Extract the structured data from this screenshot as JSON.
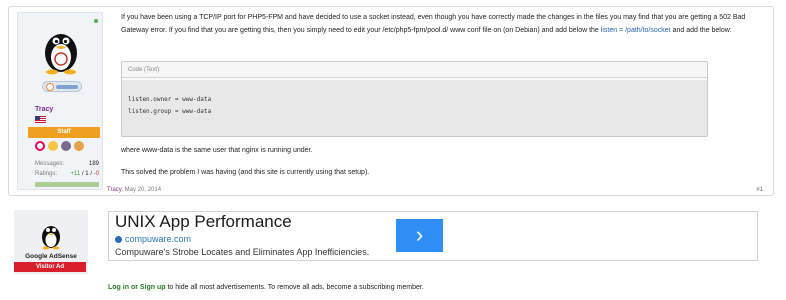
{
  "post": {
    "user": {
      "name": "Tracy",
      "role_banner": "Staff",
      "stats": [
        {
          "label": "Messages:",
          "value": "189"
        }
      ],
      "ratings": {
        "label": "Ratings:",
        "plus": "+11",
        "neutral": "1",
        "minus": "-0"
      }
    },
    "body": {
      "para1_a": "If you have been using a TCP/IP port for PHP5-FPM and have decided to use a socket instead, even though you have correctly made the changes in the files you may find that you are getting a 502 Bad Gateway error. If you find that you are getting this, then you simply need to edit your /etc/php5-fpm/pool.d/ www conf file on (on Debian) and add below the ",
      "para1_link": "listen = /path/to/socket",
      "para1_b": " and add the below:",
      "code_header": "Code (Text):",
      "code_line1": "listen.owner = www-data",
      "code_line2": "listen.group = www-data",
      "after1": "where www-data is the same user that nginx is running under.",
      "after2": "This solved the problem I was having (and this site is currently using that setup)."
    },
    "meta": {
      "author": "Tracy",
      "date": ", May 20, 2014",
      "number": "#1"
    }
  },
  "ad": {
    "user": {
      "name": "Google AdSense",
      "banner": "Visitor Ad"
    },
    "title": "UNIX App Performance",
    "url": "compuware.com",
    "description": "Compuware's Strobe Locates and Eliminates App Inefficiencies.",
    "cta_icon": "›"
  },
  "signup": {
    "link": "Log in or Sign up",
    "text": " to hide all most advertisements. To remove all ads, become a subscribing member."
  },
  "colors": {
    "staff": "#f0a020",
    "visitor": "#d9202a",
    "username": "#7b2d91",
    "link": "#2b64b0"
  }
}
